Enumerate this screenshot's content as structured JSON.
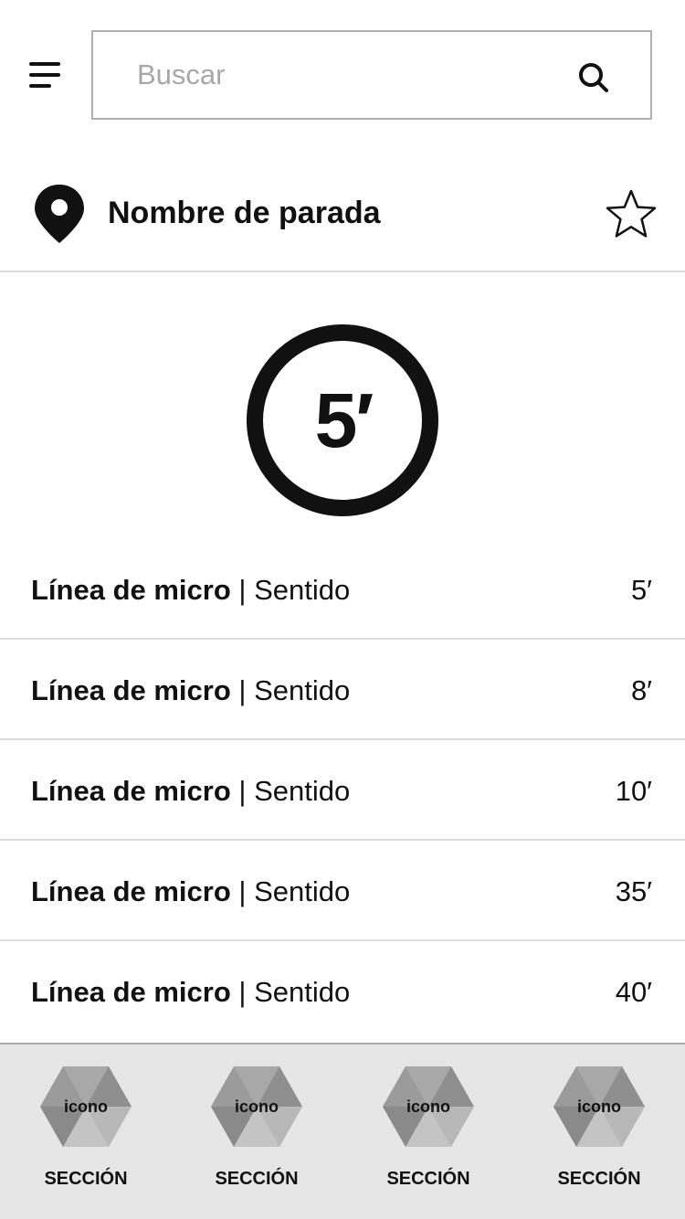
{
  "header": {
    "search_placeholder": "Buscar",
    "search_value": ""
  },
  "stop": {
    "name": "Nombre de parada",
    "favorite": false
  },
  "next_arrival": {
    "value": "5′"
  },
  "departures": [
    {
      "line": "Línea de micro",
      "separator": "|",
      "direction": "Sentido",
      "time": "5′"
    },
    {
      "line": "Línea de micro",
      "separator": "|",
      "direction": "Sentido",
      "time": "8′"
    },
    {
      "line": "Línea de micro",
      "separator": "|",
      "direction": "Sentido",
      "time": "10′"
    },
    {
      "line": "Línea de micro",
      "separator": "|",
      "direction": "Sentido",
      "time": "35′"
    },
    {
      "line": "Línea de micro",
      "separator": "|",
      "direction": "Sentido",
      "time": "40′"
    }
  ],
  "bottom_nav": {
    "items": [
      {
        "icon_text": "icono",
        "label": "SECCIÓN"
      },
      {
        "icon_text": "icono",
        "label": "SECCIÓN"
      },
      {
        "icon_text": "icono",
        "label": "SECCIÓN"
      },
      {
        "icon_text": "icono",
        "label": "SECCIÓN"
      }
    ]
  },
  "icons": {
    "menu": "hamburger-menu-icon",
    "search": "search-icon",
    "location": "map-pin-icon",
    "favorite": "star-outline-icon",
    "nav_placeholder": "placeholder-hexagon-icon"
  },
  "colors": {
    "text": "#111111",
    "divider": "#dddddd",
    "search_border": "#b0b0b0",
    "placeholder": "#a7a7a7",
    "nav_background": "#e6e6e6"
  }
}
